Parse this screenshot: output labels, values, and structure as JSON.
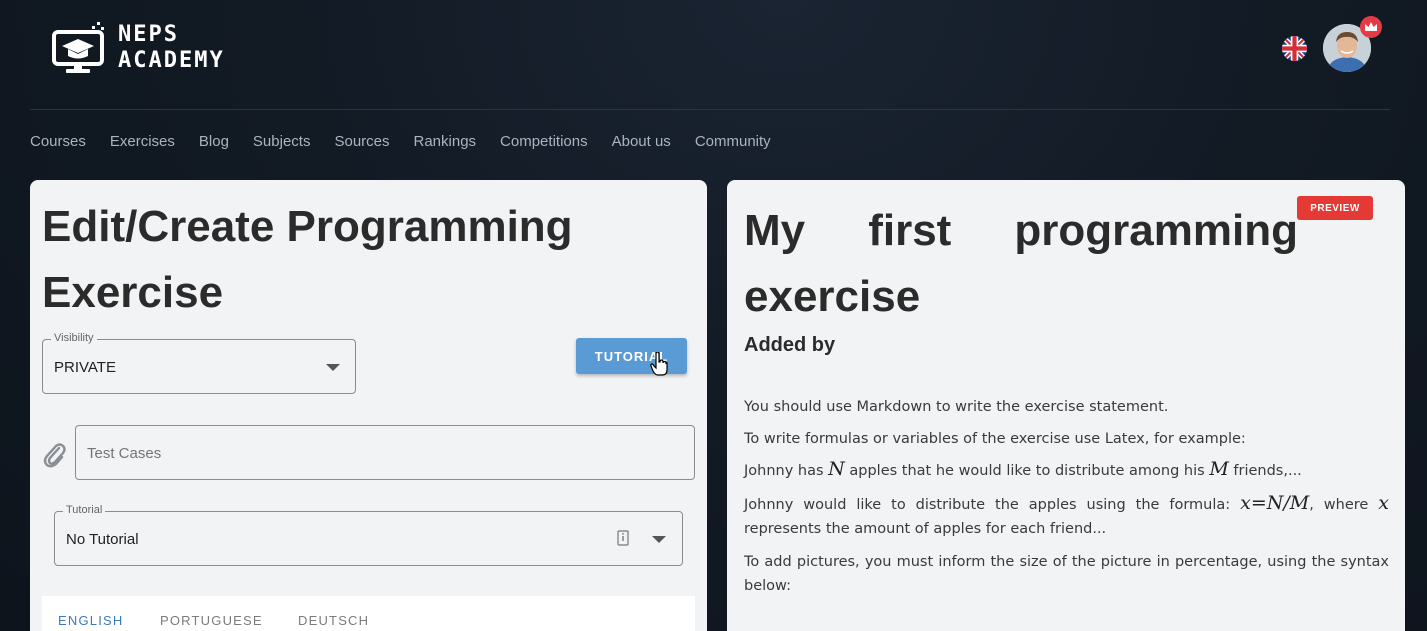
{
  "brand": {
    "line1": "NEPS",
    "line2": "ACADEMY"
  },
  "icons": {
    "logo": "graduation-cap-monitor-icon",
    "flag": "uk-flag-icon",
    "avatar": "user-avatar",
    "crown": "crown-icon",
    "paperclip": "paperclip-icon",
    "info": "info-icon",
    "dropdown": "chevron-down-icon"
  },
  "nav": {
    "items": [
      "Courses",
      "Exercises",
      "Blog",
      "Subjects",
      "Sources",
      "Rankings",
      "Competitions",
      "About us",
      "Community"
    ]
  },
  "editor": {
    "title": "Edit/Create Programming Exercise",
    "visibility": {
      "legend": "Visibility",
      "value": "PRIVATE"
    },
    "tutorial_button": "TUTORIAL",
    "test_cases": {
      "placeholder": "Test Cases"
    },
    "tutorial_select": {
      "legend": "Tutorial",
      "value": "No Tutorial"
    },
    "lang_tabs": [
      "ENGLISH",
      "PORTUGUESE",
      "DEUTSCH"
    ],
    "active_lang": "ENGLISH"
  },
  "preview": {
    "badge": "PREVIEW",
    "title_words_line1": [
      "My",
      "first",
      "programming"
    ],
    "title_line2": "exercise",
    "added_by": "Added by",
    "p1": "You should use Markdown to write the exercise statement.",
    "p2": "To write formulas or variables of the exercise use Latex, for example:",
    "p3_a": "Johnny has ",
    "p3_var1": "N",
    "p3_b": " apples that he would like to distribute among his ",
    "p3_var2": "M",
    "p3_c": " friends,...",
    "p4_a": "Johnny would like to distribute the apples using the formula: ",
    "p4_formula": "x=N/M",
    "p4_b": ", where ",
    "p4_var": "x",
    "p4_c": " represents the amount of apples for each friend...",
    "p5": "To add pictures, you must inform the size of the picture in percentage, using the syntax below:"
  },
  "colors": {
    "accent": "#5b9bd5",
    "preview_badge": "#e53935",
    "active_tab": "#3b7bbd",
    "background": "#121a24"
  }
}
